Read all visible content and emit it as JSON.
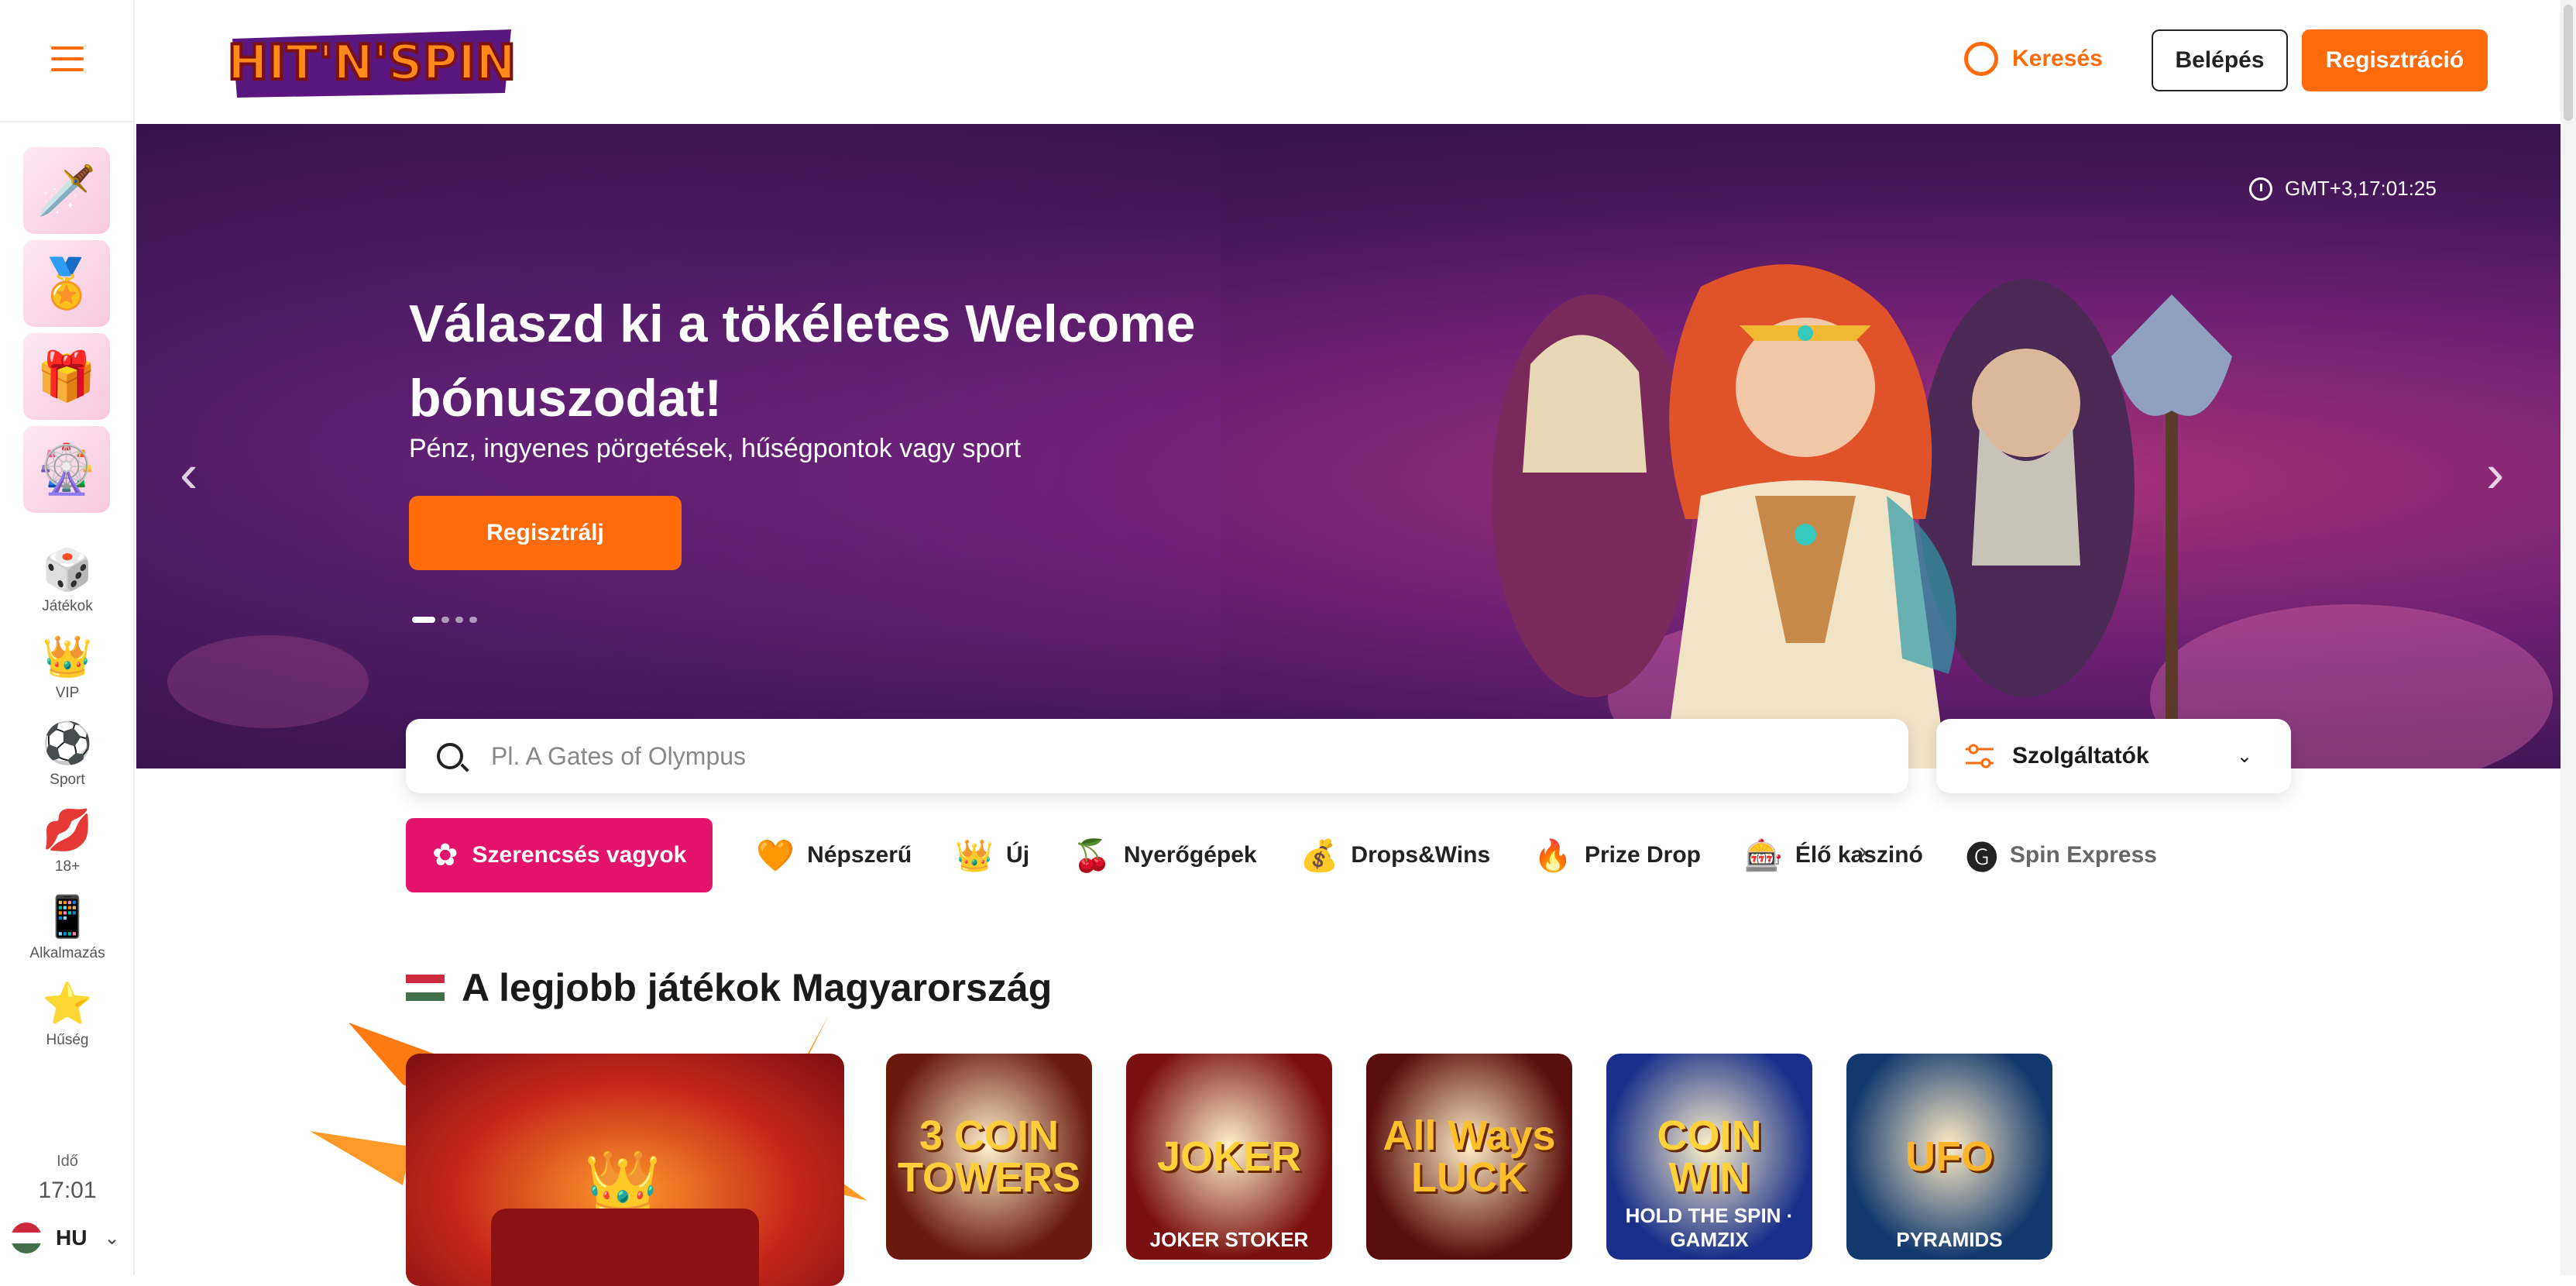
{
  "brand": {
    "logo_text": "HIT'N'SPIN",
    "accent": "#ff6b0a",
    "pink": "#e3126b"
  },
  "header": {
    "search_label": "Keresés",
    "login_label": "Belépés",
    "register_label": "Regisztráció"
  },
  "sidebar": {
    "promos": [
      {
        "name": "sword-promo",
        "icon": "🗡️"
      },
      {
        "name": "medal-promo",
        "icon": "🏅"
      },
      {
        "name": "gift-promo",
        "icon": "🎁"
      },
      {
        "name": "wheel-promo",
        "icon": "🎡"
      }
    ],
    "items": [
      {
        "label": "Játékok",
        "icon": "dice-icon"
      },
      {
        "label": "VIP",
        "icon": "crown-icon"
      },
      {
        "label": "Sport",
        "icon": "ball-icon"
      },
      {
        "label": "18+",
        "icon": "lips-icon"
      },
      {
        "label": "Alkalmazás",
        "icon": "phone-icon"
      },
      {
        "label": "Hűség",
        "icon": "star-icon"
      }
    ],
    "time_label": "Idő",
    "time_value": "17:01",
    "language": "HU"
  },
  "hero": {
    "title": "Válaszd ki a tökéletes Welcome bónuszodat!",
    "subtitle": "Pénz, ingyenes pörgetések, hűségpontok vagy sport",
    "cta": "Regisztrálj",
    "clock": "GMT+3,17:01:25",
    "slide_count": 4,
    "active_slide": 1
  },
  "search": {
    "placeholder": "Pl. A Gates of Olympus",
    "providers_label": "Szolgáltatók"
  },
  "categories": {
    "active": "Szerencsés vagyok",
    "items": [
      {
        "label": "Népszerű",
        "icon": "🧡"
      },
      {
        "label": "Új",
        "icon": "👑"
      },
      {
        "label": "Nyerőgépek",
        "icon": "🍒"
      },
      {
        "label": "Drops&Wins",
        "icon": "💰"
      },
      {
        "label": "Prize Drop",
        "icon": "🔥"
      },
      {
        "label": "Élő kaszinó",
        "icon": "🎰"
      },
      {
        "label": "Spin Express",
        "icon": "🅖"
      }
    ]
  },
  "section": {
    "title": "A legjobb játékok Magyarország"
  },
  "games": [
    {
      "title": "3 COIN TOWERS",
      "sub": "",
      "bg": "#6b1a0f",
      "fg": "#ffce3a"
    },
    {
      "title": "JOKER",
      "sub": "JOKER STOKER",
      "bg": "#7a1010",
      "fg": "#ffd23a"
    },
    {
      "title": "All Ways LUCK",
      "sub": "",
      "bg": "#5a0d0d",
      "fg": "#ffc02a"
    },
    {
      "title": "COIN WIN",
      "sub": "HOLD THE SPIN · GAMZIX",
      "bg": "#1a2f8a",
      "fg": "#ffd23a"
    },
    {
      "title": "UFO",
      "sub": "PYRAMIDS",
      "bg": "#12396e",
      "fg": "#ffb52a"
    }
  ]
}
